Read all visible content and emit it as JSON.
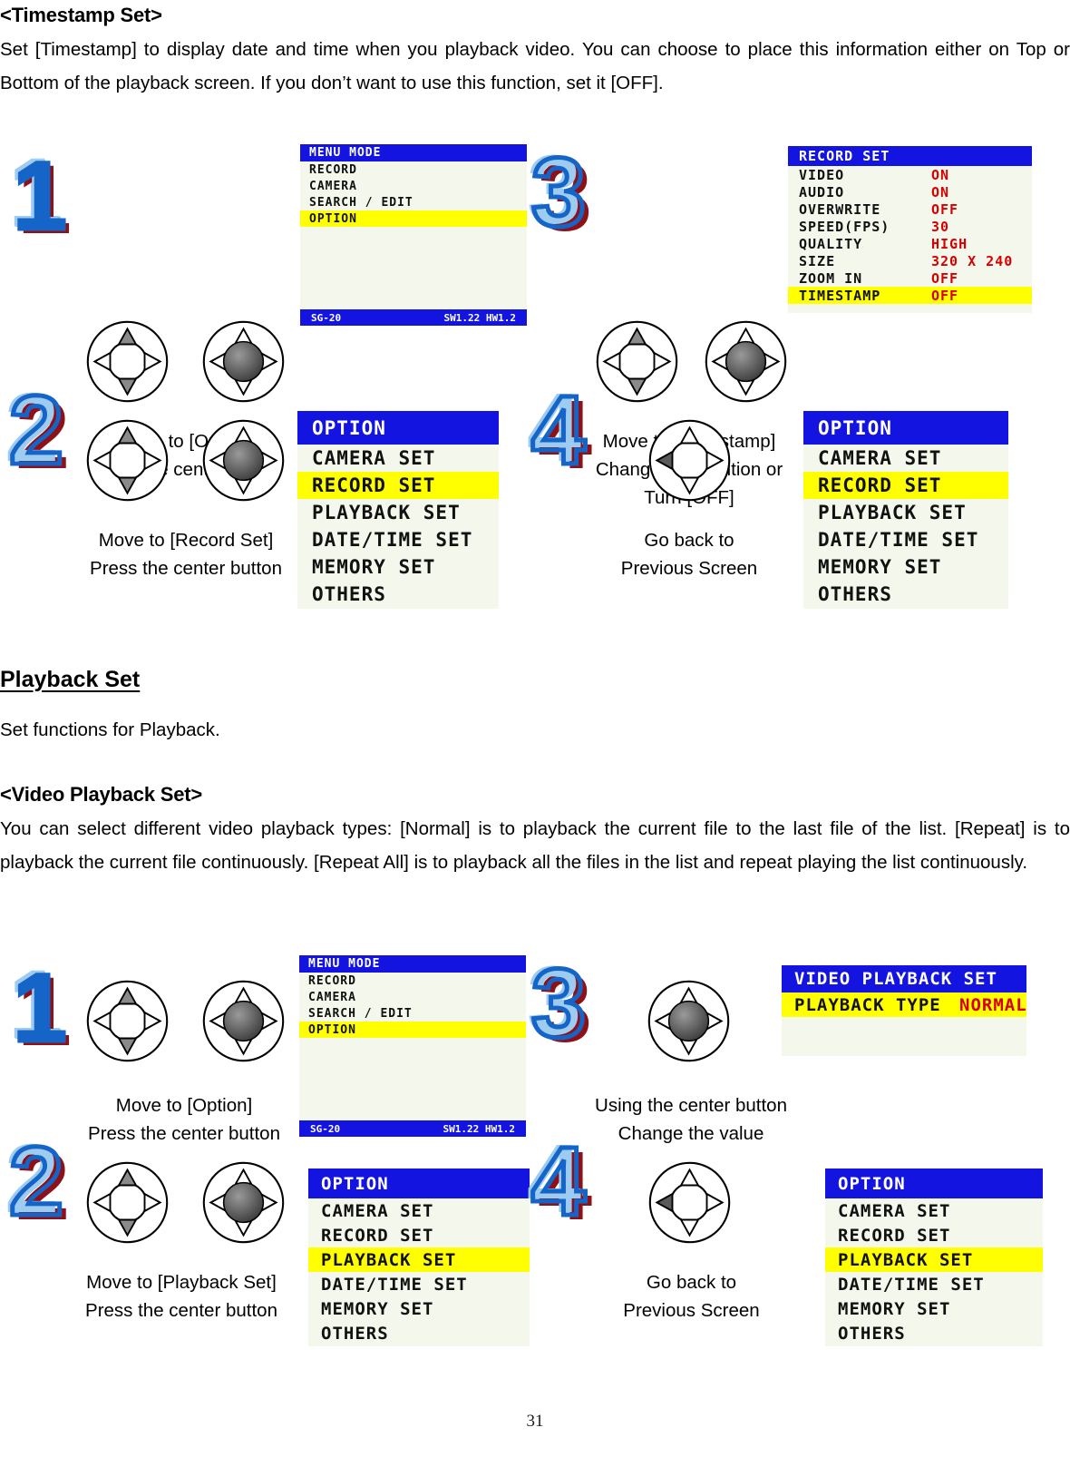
{
  "page": {
    "number": "31"
  },
  "section1": {
    "heading": "<Timestamp Set>",
    "paragraph": "Set [Timestamp] to display date and time when you playback video. You can choose to place this information either on Top or Bottom of the playback screen. If you don’t want to use this function, set it [OFF].",
    "steps": [
      {
        "num": "1",
        "caption_line1": "Move to [Option]",
        "caption_line2": "Press the center button",
        "caption_line3": ""
      },
      {
        "num": "2",
        "caption_line1": "Move to [Record Set]",
        "caption_line2": "Press the center button",
        "caption_line3": ""
      },
      {
        "num": "3",
        "caption_line1": "Move to [Timestamp]",
        "caption_line2": "Change the position or",
        "caption_line3": "Turn [OFF]"
      },
      {
        "num": "4",
        "caption_line1": "Go back to",
        "caption_line2": "Previous Screen",
        "caption_line3": ""
      }
    ],
    "screens": {
      "menu_mode": {
        "title": "MENU MODE",
        "items": [
          "RECORD",
          "CAMERA",
          "SEARCH / EDIT",
          "OPTION"
        ],
        "highlighted": "OPTION",
        "footer_left": "SG-20",
        "footer_right": "SW1.22 HW1.2"
      },
      "option_record": {
        "title": "OPTION",
        "items": [
          "CAMERA SET",
          "RECORD SET",
          "PLAYBACK SET",
          "DATE/TIME SET",
          "MEMORY SET",
          "OTHERS"
        ],
        "highlighted": "RECORD SET"
      },
      "record_set": {
        "title": "RECORD SET",
        "rows": [
          {
            "label": "VIDEO",
            "value": "ON"
          },
          {
            "label": "AUDIO",
            "value": "ON"
          },
          {
            "label": "OVERWRITE",
            "value": "OFF"
          },
          {
            "label": "SPEED(FPS)",
            "value": "30"
          },
          {
            "label": "QUALITY",
            "value": "HIGH"
          },
          {
            "label": "SIZE",
            "value": "320 X 240"
          },
          {
            "label": "ZOOM IN",
            "value": "OFF"
          },
          {
            "label": "TIMESTAMP",
            "value": "OFF"
          }
        ],
        "highlighted": "TIMESTAMP"
      },
      "option_record2": {
        "title": "OPTION",
        "items": [
          "CAMERA SET",
          "RECORD SET",
          "PLAYBACK SET",
          "DATE/TIME SET",
          "MEMORY SET",
          "OTHERS"
        ],
        "highlighted": "RECORD SET"
      }
    }
  },
  "middle": {
    "heading": "Playback Set",
    "intro": "Set functions for Playback.",
    "subheading": "<Video Playback Set>",
    "paragraph": "  You can select different video playback types: [Normal] is to playback the current file to the last file of the list. [Repeat] is to playback the current file continuously. [Repeat All] is to playback all the files in the list and repeat playing the list continuously."
  },
  "section2": {
    "steps": [
      {
        "num": "1",
        "caption_line1": "Move to [Option]",
        "caption_line2": "Press the center button"
      },
      {
        "num": "2",
        "caption_line1": "Move to [Playback Set]",
        "caption_line2": "Press the center button"
      },
      {
        "num": "3",
        "caption_line1": "Using the center button",
        "caption_line2": "Change the value"
      },
      {
        "num": "4",
        "caption_line1": "Go back to",
        "caption_line2": "Previous Screen"
      }
    ],
    "screens": {
      "menu_mode": {
        "title": "MENU MODE",
        "items": [
          "RECORD",
          "CAMERA",
          "SEARCH / EDIT",
          "OPTION"
        ],
        "highlighted": "OPTION",
        "footer_left": "SG-20",
        "footer_right": "SW1.22 HW1.2"
      },
      "option_playback": {
        "title": "OPTION",
        "items": [
          "CAMERA SET",
          "RECORD SET",
          "PLAYBACK SET",
          "DATE/TIME SET",
          "MEMORY SET",
          "OTHERS"
        ],
        "highlighted": "PLAYBACK SET"
      },
      "video_playback_set": {
        "title": "VIDEO PLAYBACK SET",
        "rows": [
          {
            "label": "PLAYBACK TYPE",
            "value": "NORMAL"
          }
        ],
        "highlighted": "PLAYBACK TYPE"
      },
      "option_playback2": {
        "title": "OPTION",
        "items": [
          "CAMERA SET",
          "RECORD SET",
          "PLAYBACK SET",
          "DATE/TIME SET",
          "MEMORY SET",
          "OTHERS"
        ],
        "highlighted": "PLAYBACK SET"
      }
    }
  },
  "colors": {
    "lcd_title_bg": "#1414e0",
    "lcd_highlight": "#ffff00",
    "lcd_value_text": "#d60000",
    "lcd_screen_bg": "#f4f7ec",
    "step_number": "#1565C8"
  },
  "icons": {
    "dpad_plain": "dpad-icon",
    "dpad_center_pressed": "dpad-center-pressed-icon",
    "dpad_left_pressed": "dpad-left-pressed-icon"
  }
}
